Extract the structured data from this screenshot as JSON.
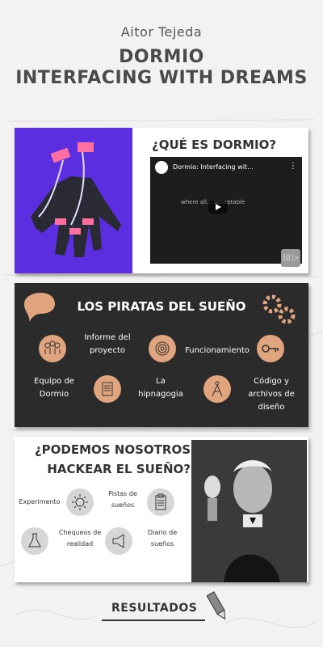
{
  "header": {
    "author": "Aitor Tejeda",
    "title_line1": "DORMIO",
    "title_line2": "INTERFACING WITH DREAMS"
  },
  "card1": {
    "heading": "¿QUÉ ES DORMIO?",
    "video": {
      "title": "Dormio: Interfacing wit...",
      "subtitle": "where all... acceptable"
    }
  },
  "card2": {
    "heading": "LOS PIRATAS DEL SUEÑO",
    "items": [
      {
        "label": "Informe del proyecto"
      },
      {
        "label": "Funcionamiento"
      },
      {
        "label": "Equipo de Dormio"
      },
      {
        "label": "La hipnagogia"
      },
      {
        "label": "Código y archivos de diseño"
      }
    ]
  },
  "card3": {
    "heading_line1": "¿PODEMOS NOSOTROS",
    "heading_line2": "HACKEAR EL SUEÑO?",
    "items": [
      {
        "label": "Experimento"
      },
      {
        "label": "Pistas de sueños"
      },
      {
        "label": "Chequeos de realidad"
      },
      {
        "label": "Diario de sueños"
      }
    ]
  },
  "footer": {
    "results": "RESULTADOS"
  },
  "colors": {
    "accent": "#e0a57e",
    "dark_card": "#2b2b2b",
    "glove_bg": "#5b2fe0"
  }
}
